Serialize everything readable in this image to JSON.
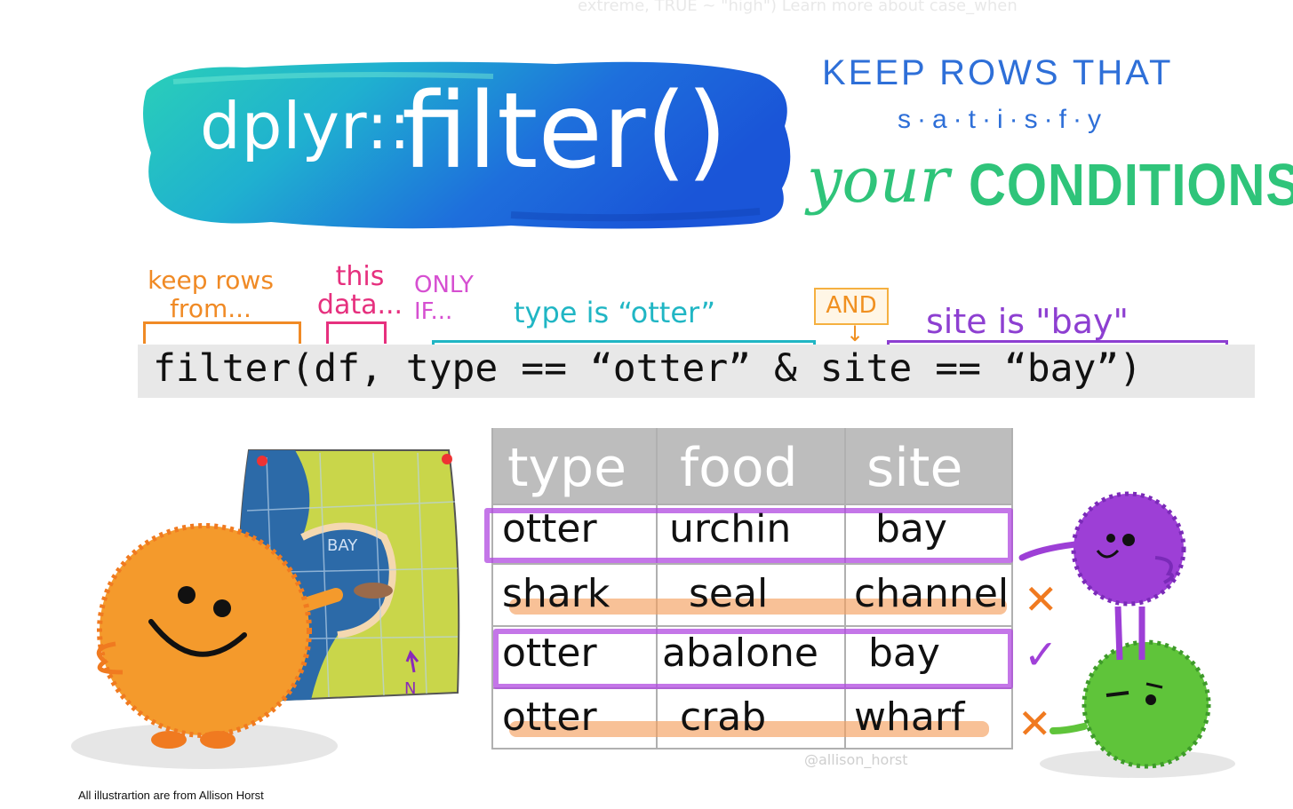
{
  "background": {
    "partial_text": "extreme, TRUE ~ \"high\") Learn more about case_when"
  },
  "title": {
    "prefix": "dplyr::",
    "function": "filter()"
  },
  "tagline": {
    "line1": "KEEP ROWS THAT",
    "line2": "s·a·t·i·s·f·y",
    "line3a": "your",
    "line3b": "CONDITIONS"
  },
  "annotations": {
    "keep_rows_from": "keep rows from...",
    "this_data": "this data...",
    "only_if": "ONLY IF...",
    "type_is_otter": "type is “otter”",
    "and": "AND",
    "site_is_bay": "site is \"bay\""
  },
  "code": "filter(df, type == “otter” & site == “bay”)",
  "table": {
    "columns": [
      "type",
      "food",
      "site"
    ],
    "rows": [
      {
        "type": "otter",
        "food": "urchin",
        "site": "bay",
        "kept": true
      },
      {
        "type": "shark",
        "food": "seal",
        "site": "channel",
        "kept": false
      },
      {
        "type": "otter",
        "food": "abalone",
        "site": "bay",
        "kept": true
      },
      {
        "type": "otter",
        "food": "crab",
        "site": "wharf",
        "kept": false
      }
    ]
  },
  "map_label": "BAY",
  "compass_label": "N",
  "signature": "@allison_horst",
  "credit": "All illustrartion are from Allison Horst",
  "colors": {
    "title_blue": "#1f5fd6",
    "title_teal": "#27c7b8",
    "keep_purple": "#b048e0",
    "reject_orange": "#f5a060",
    "monster_orange": "#f49a2c",
    "monster_purple": "#9d3fd6",
    "monster_green": "#5fc43a"
  }
}
